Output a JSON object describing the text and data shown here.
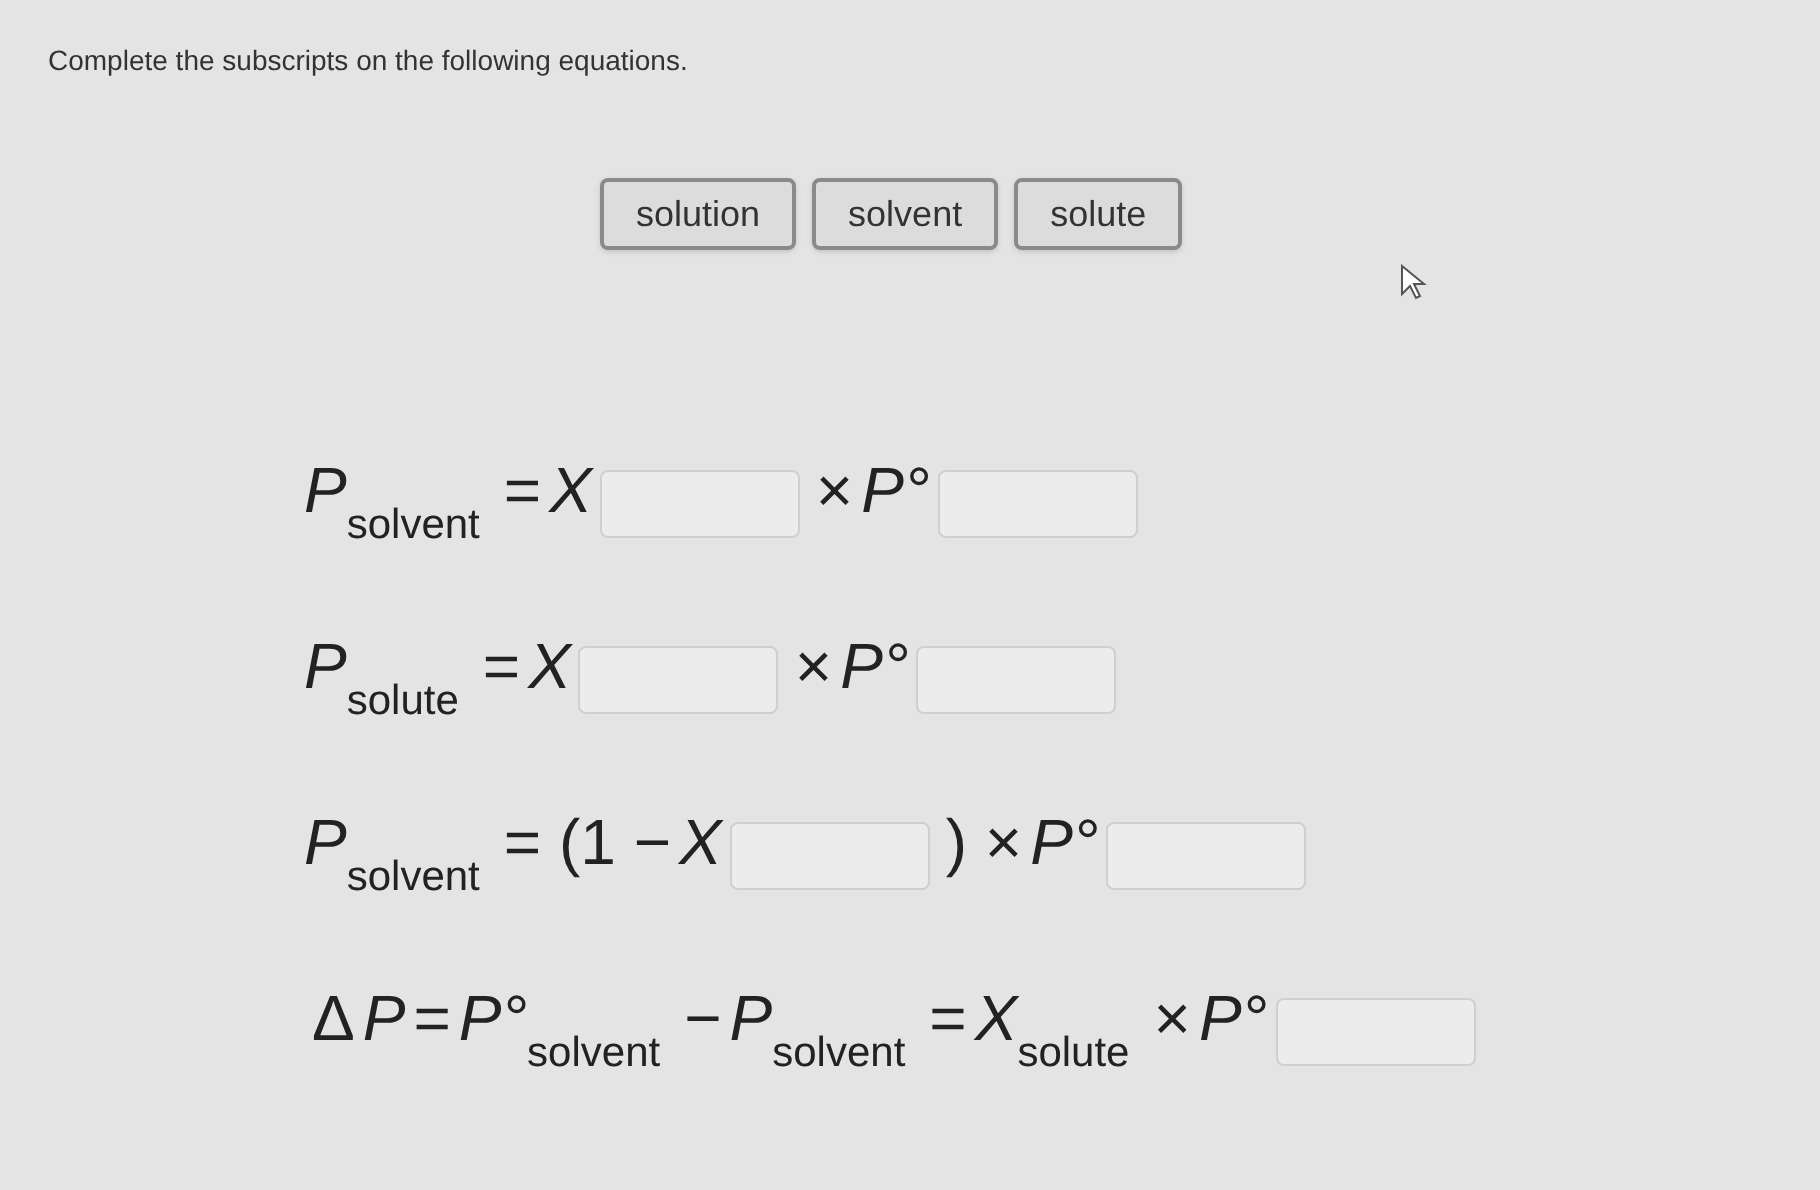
{
  "instruction": "Complete the subscripts on the following equations.",
  "chips": [
    {
      "label": "solution"
    },
    {
      "label": "solvent"
    },
    {
      "label": "solute"
    }
  ],
  "equations": [
    {
      "parts": [
        {
          "kind": "var",
          "text": "P"
        },
        {
          "kind": "sub",
          "text": "solvent"
        },
        {
          "kind": "op",
          "text": "="
        },
        {
          "kind": "var",
          "text": "X"
        },
        {
          "kind": "blank"
        },
        {
          "kind": "op",
          "text": "×"
        },
        {
          "kind": "var",
          "text": "P°"
        },
        {
          "kind": "blank"
        }
      ]
    },
    {
      "parts": [
        {
          "kind": "var",
          "text": "P"
        },
        {
          "kind": "sub",
          "text": "solute"
        },
        {
          "kind": "op",
          "text": "="
        },
        {
          "kind": "var",
          "text": "X"
        },
        {
          "kind": "blank"
        },
        {
          "kind": "op",
          "text": "×"
        },
        {
          "kind": "var",
          "text": "P°"
        },
        {
          "kind": "blank"
        }
      ]
    },
    {
      "parts": [
        {
          "kind": "var",
          "text": "P"
        },
        {
          "kind": "sub",
          "text": "solvent"
        },
        {
          "kind": "op",
          "text": "= (1 −"
        },
        {
          "kind": "var",
          "text": "X"
        },
        {
          "kind": "blank"
        },
        {
          "kind": "op",
          "text": ") ×"
        },
        {
          "kind": "var",
          "text": "P°"
        },
        {
          "kind": "blank"
        }
      ]
    },
    {
      "parts": [
        {
          "kind": "op",
          "text": "Δ"
        },
        {
          "kind": "var",
          "text": "P"
        },
        {
          "kind": "op",
          "text": "="
        },
        {
          "kind": "var",
          "text": "P°"
        },
        {
          "kind": "sub",
          "text": "solvent"
        },
        {
          "kind": "op",
          "text": "−"
        },
        {
          "kind": "var",
          "text": "P"
        },
        {
          "kind": "sub",
          "text": "solvent"
        },
        {
          "kind": "op",
          "text": "="
        },
        {
          "kind": "var",
          "text": "X"
        },
        {
          "kind": "sub",
          "text": "solute"
        },
        {
          "kind": "op",
          "text": "×"
        },
        {
          "kind": "var",
          "text": "P°"
        },
        {
          "kind": "blank"
        }
      ]
    }
  ]
}
